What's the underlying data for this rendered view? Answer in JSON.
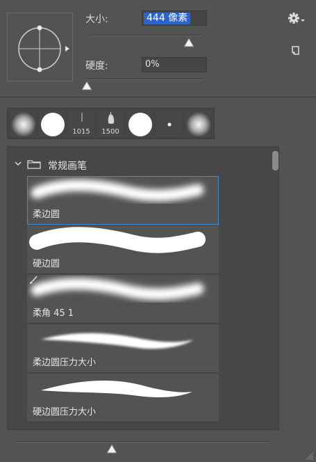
{
  "brush": {
    "size_label": "大小:",
    "size_value": "444 像素",
    "size_fraction": 0.88,
    "hardness_label": "硬度:",
    "hardness_value": "0%",
    "hardness_fraction": 0.0
  },
  "icons": {
    "gear": "gear-icon",
    "new_preset": "new-preset-icon",
    "folder": "folder-icon",
    "chevron": "chevron-down-icon",
    "brush": "brush-icon",
    "resize": "resize-grip-icon"
  },
  "recent_brushes": [
    {
      "kind": "soft-round",
      "label": ""
    },
    {
      "kind": "hard-round",
      "label": ""
    },
    {
      "kind": "tick",
      "label": "1015"
    },
    {
      "kind": "drip",
      "label": "1500"
    },
    {
      "kind": "hard-round",
      "label": ""
    },
    {
      "kind": "dot",
      "label": ""
    },
    {
      "kind": "soft-round",
      "label": ""
    }
  ],
  "preset_group": {
    "name": "常规画笔"
  },
  "presets": [
    {
      "name": "柔边圆",
      "stroke": "soft-wave",
      "selected": true
    },
    {
      "name": "硬边圆",
      "stroke": "hard-wave",
      "selected": false
    },
    {
      "name": "柔角 45 1",
      "stroke": "soft-wave",
      "selected": false
    },
    {
      "name": "柔边圆压力大小",
      "stroke": "taper-soft",
      "selected": false
    },
    {
      "name": "硬边圆压力大小",
      "stroke": "taper-hard",
      "selected": false
    }
  ],
  "preview_size_fraction": 0.38,
  "colors": {
    "selection": "#2e64c9",
    "selected_outline": "#3b8bd8"
  }
}
